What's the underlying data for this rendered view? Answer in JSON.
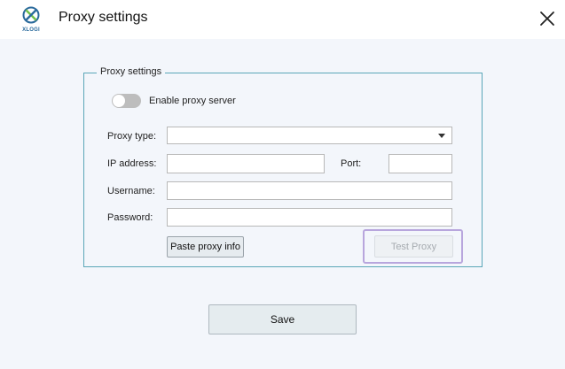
{
  "window": {
    "title": "Proxy settings",
    "logo_text": "XLOGI"
  },
  "group": {
    "legend": "Proxy settings",
    "enable_label": "Enable proxy server",
    "enable_on": false,
    "proxy_type_label": "Proxy type:",
    "proxy_type_value": "",
    "ip_label": "IP address:",
    "ip_value": "",
    "port_label": "Port:",
    "port_value": "",
    "username_label": "Username:",
    "username_value": "",
    "password_label": "Password:",
    "password_value": "",
    "paste_button": "Paste proxy info",
    "test_button": "Test Proxy"
  },
  "footer": {
    "save_button": "Save"
  },
  "colors": {
    "border_accent": "#5aa6b8",
    "highlight_outline": "#b8a6dd",
    "logo_blue": "#2a6a9c",
    "logo_green": "#6fbf4a"
  },
  "icons": {
    "logo": "xlogi-logo-icon",
    "close": "close-icon",
    "dropdown": "chevron-down-icon"
  }
}
